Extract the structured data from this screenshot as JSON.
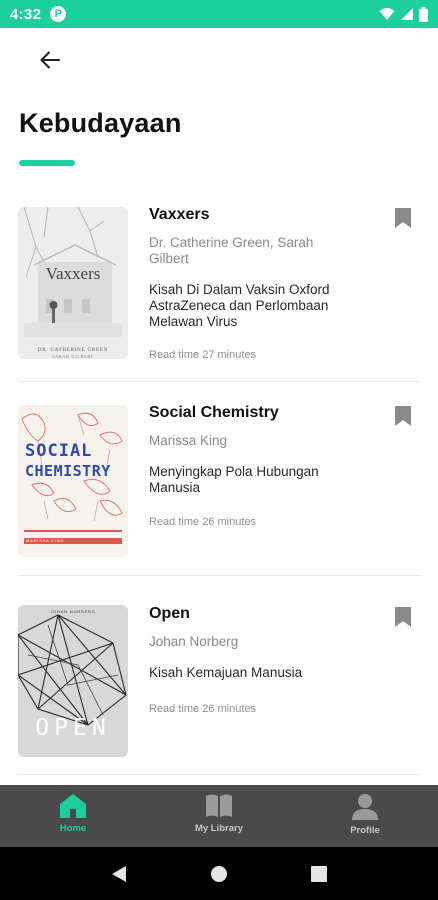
{
  "status_bar": {
    "time": "4:32",
    "app_icon_letter": "P"
  },
  "header": {
    "title": "Kebudayaan"
  },
  "books": [
    {
      "title": "Vaxxers",
      "author": "Dr. Catherine Green, Sarah Gilbert",
      "description": "Kisah Di Dalam Vaksin Oxford AstraZeneca dan Perlombaan Melawan Virus",
      "read_time": "Read time 27 minutes",
      "cover_title": "Vaxxers",
      "cover_author_line1": "DR. CATHERINE GREEN",
      "cover_author_line2": "SARAH GILBERT"
    },
    {
      "title": "Social Chemistry",
      "author": "Marissa King",
      "description": "Menyingkap Pola Hubungan Manusia",
      "read_time": "Read time 26 minutes",
      "cover_title_line1": "SOCIAL",
      "cover_title_line2": "CHEMISTRY",
      "cover_author": "MARISSA KING"
    },
    {
      "title": "Open",
      "author": "Johan Norberg",
      "description": "Kisah Kemajuan Manusia",
      "read_time": "Read time 26 minutes",
      "cover_author": "JOHAN NORBERG",
      "cover_title": "OPEN"
    }
  ],
  "bottom_nav": {
    "items": [
      {
        "label": "Home",
        "icon": "home-icon",
        "active": true
      },
      {
        "label": "My Library",
        "icon": "book-icon",
        "active": false
      },
      {
        "label": "Profile",
        "icon": "person-icon",
        "active": false
      }
    ]
  },
  "colors": {
    "accent": "#1ccf9f",
    "nav_bg": "#4a4a4a",
    "text_muted": "#8a8a8a"
  }
}
